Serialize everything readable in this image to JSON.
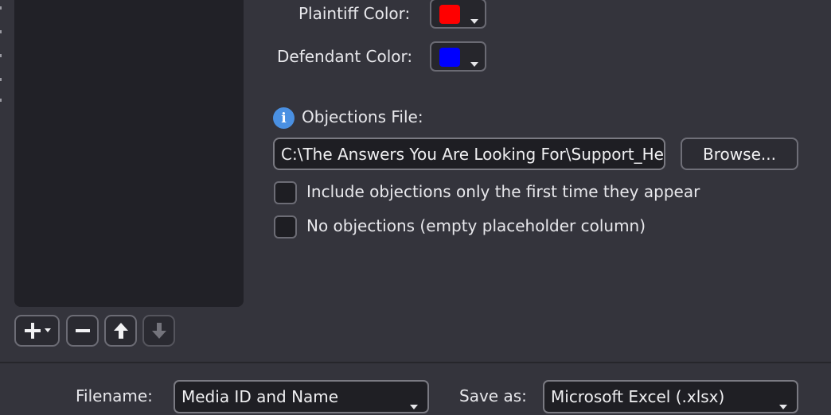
{
  "form": {
    "plaintiff_color_label": "Plaintiff Color:",
    "plaintiff_color": "#ff0000",
    "defendant_color_label": "Defendant Color:",
    "defendant_color": "#0000ff",
    "objections_label": "Objections File:",
    "objections_path": "C:\\The Answers You Are Looking For\\Support_He",
    "browse_label": "Browse...",
    "first_time_label": "Include objections only the first time they appear",
    "no_objections_label": "No objections (empty placeholder column)"
  },
  "list_toolbar": {
    "icons": [
      "add-icon",
      "remove-icon",
      "arrow-up-icon",
      "arrow-down-icon"
    ]
  },
  "footer": {
    "filename_label": "Filename:",
    "filename_value": "Media ID and Name",
    "save_as_label": "Save as:",
    "save_as_value": "Microsoft Excel (.xlsx)"
  }
}
